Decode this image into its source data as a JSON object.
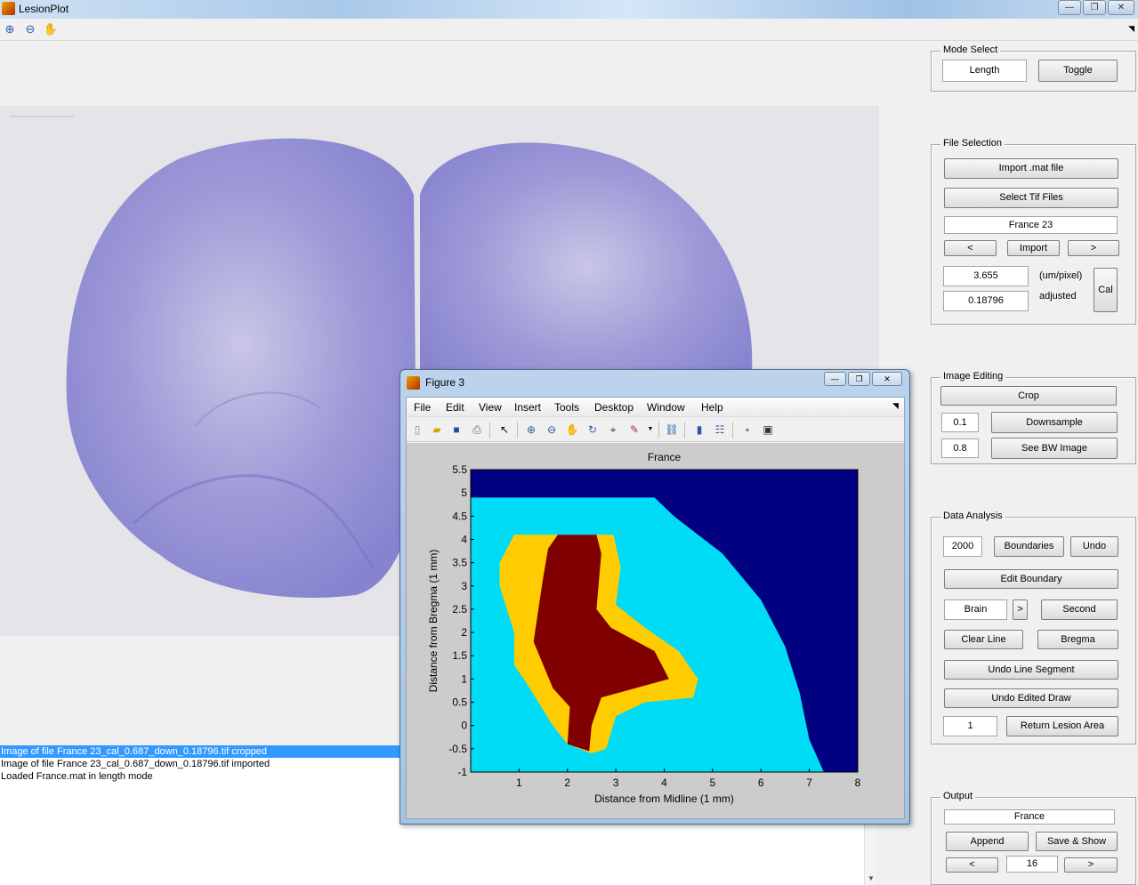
{
  "window": {
    "title": "LesionPlot"
  },
  "toolbar": {
    "icons": [
      "zoom-in-icon",
      "zoom-out-icon",
      "pan-hand-icon"
    ]
  },
  "log": {
    "lines": [
      "Image of file France 23_cal_0.687_down_0.18796.tif cropped",
      "Image of file France 23_cal_0.687_down_0.18796.tif imported",
      "Loaded France.mat in length mode"
    ]
  },
  "mode_select": {
    "title": "Mode Select",
    "value": "Length",
    "toggle": "Toggle"
  },
  "file_selection": {
    "title": "File Selection",
    "import_mat": "Import .mat file",
    "select_tif": "Select Tif Files",
    "file_name": "France 23",
    "prev": "<",
    "import": "Import",
    "next": ">",
    "scale_value": "3.655",
    "scale_unit": "(um/pixel)",
    "adjusted_value": "0.18796",
    "adjusted_label": "adjusted",
    "cal": "Cal"
  },
  "image_editing": {
    "title": "Image Editing",
    "crop": "Crop",
    "downsample_value": "0.1",
    "downsample": "Downsample",
    "bw_value": "0.8",
    "see_bw": "See BW Image"
  },
  "data_analysis": {
    "title": "Data Analysis",
    "boundary_value": "2000",
    "boundaries": "Boundaries",
    "undo": "Undo",
    "edit_boundary": "Edit Boundary",
    "region": "Brain",
    "region_next": ">",
    "second": "Second",
    "clear_line": "Clear Line",
    "bregma": "Bregma",
    "undo_line_segment": "Undo Line Segment",
    "undo_edited_draw": "Undo Edited Draw",
    "lesion_value": "1",
    "return_lesion_area": "Return Lesion Area"
  },
  "output": {
    "title": "Output",
    "name": "France",
    "append": "Append",
    "save_show": "Save & Show",
    "prev": "<",
    "index": "16",
    "next": ">"
  },
  "figure": {
    "title": "Figure 3",
    "menu": [
      "File",
      "Edit",
      "View",
      "Insert",
      "Tools",
      "Desktop",
      "Window",
      "Help"
    ]
  },
  "chart_data": {
    "type": "heatmap",
    "title": "France",
    "xlabel": "Distance from Midline (1 mm)",
    "ylabel": "Distance from Bregma (1 mm)",
    "xlim": [
      0,
      8
    ],
    "ylim": [
      -1,
      5.5
    ],
    "x_ticks": [
      "1",
      "2",
      "3",
      "4",
      "5",
      "6",
      "7",
      "8"
    ],
    "y_ticks": [
      "5.5",
      "5",
      "4.5",
      "4",
      "3.5",
      "3",
      "2.5",
      "2",
      "1.5",
      "1",
      "0.5",
      "0",
      "-0.5",
      "-1"
    ],
    "colors": {
      "background": "#000080",
      "brain": "#00dcf5",
      "border": "#ffcc00",
      "lesion": "#800000"
    },
    "regions": [
      {
        "color": "#00dcf5",
        "polygon": [
          [
            0,
            4.9
          ],
          [
            3.8,
            4.9
          ],
          [
            4.2,
            4.5
          ],
          [
            5.2,
            3.7
          ],
          [
            6.0,
            2.7
          ],
          [
            6.5,
            1.7
          ],
          [
            6.8,
            0.7
          ],
          [
            7.0,
            -0.3
          ],
          [
            7.3,
            -1
          ],
          [
            0,
            -1
          ]
        ]
      },
      {
        "color": "#ffcc00",
        "polygon": [
          [
            0.9,
            4.1
          ],
          [
            2.95,
            4.1
          ],
          [
            3.1,
            3.4
          ],
          [
            3.0,
            2.6
          ],
          [
            3.6,
            2.1
          ],
          [
            4.3,
            1.6
          ],
          [
            4.7,
            1.0
          ],
          [
            4.6,
            0.6
          ],
          [
            3.6,
            0.5
          ],
          [
            3.0,
            0.2
          ],
          [
            2.8,
            -0.5
          ],
          [
            2.5,
            -0.6
          ],
          [
            2.0,
            -0.4
          ],
          [
            1.7,
            0
          ],
          [
            1.4,
            0.5
          ],
          [
            1.1,
            1.0
          ],
          [
            0.9,
            1.3
          ],
          [
            0.9,
            2.0
          ],
          [
            0.6,
            3.0
          ],
          [
            0.6,
            3.5
          ]
        ]
      },
      {
        "color": "#800000",
        "polygon": [
          [
            1.8,
            4.1
          ],
          [
            2.6,
            4.1
          ],
          [
            2.7,
            3.7
          ],
          [
            2.6,
            2.5
          ],
          [
            2.9,
            2.1
          ],
          [
            3.8,
            1.6
          ],
          [
            4.1,
            1.0
          ],
          [
            3.4,
            0.8
          ],
          [
            2.7,
            0.6
          ],
          [
            2.5,
            0
          ],
          [
            2.45,
            -0.55
          ],
          [
            2.0,
            -0.4
          ],
          [
            2.05,
            0.4
          ],
          [
            1.7,
            0.8
          ],
          [
            1.3,
            1.8
          ],
          [
            1.4,
            2.5
          ],
          [
            1.5,
            3.2
          ],
          [
            1.6,
            3.8
          ]
        ]
      }
    ]
  }
}
